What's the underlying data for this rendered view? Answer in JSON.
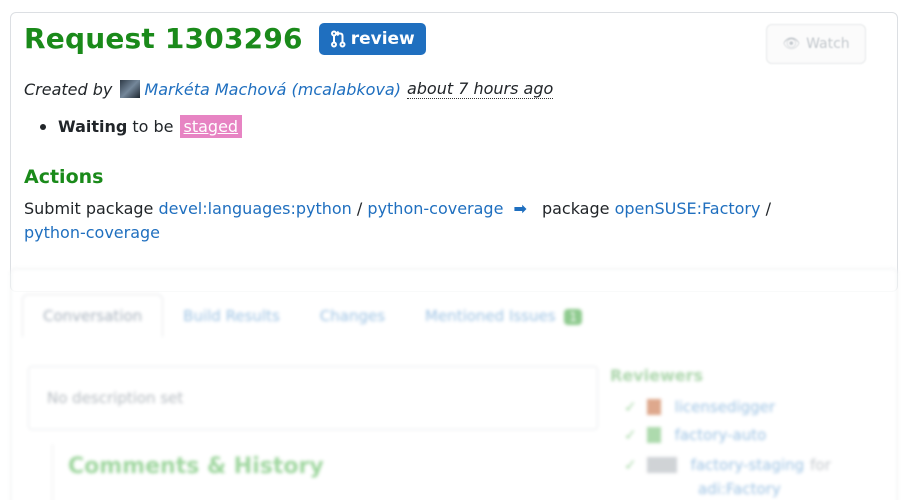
{
  "request": {
    "title": "Request 1303296",
    "badge_label": "review",
    "watch_label": "Watch"
  },
  "created": {
    "prefix": "Created by",
    "user_link": "Markéta Machová (mcalabkova)",
    "time": "about 7 hours ago"
  },
  "status": {
    "state": "Waiting",
    "middle": "to be",
    "target": "staged"
  },
  "actions": {
    "heading": "Actions",
    "prefix": "Submit package",
    "source_project": "devel:languages:python",
    "sep1": "/",
    "source_package": "python-coverage",
    "arrow": "➡",
    "mid": "package",
    "target_project": "openSUSE:Factory",
    "sep2": "/",
    "target_package": "python-coverage"
  },
  "tabs": [
    {
      "label": "Conversation"
    },
    {
      "label": "Build Results"
    },
    {
      "label": "Changes"
    },
    {
      "label": "Mentioned Issues",
      "badge": "1"
    }
  ],
  "description": {
    "text": "No description set"
  },
  "comments": {
    "heading": "Comments & History"
  },
  "reviewers": {
    "heading": "Reviewers",
    "items": [
      {
        "name": "licensedigger"
      },
      {
        "name": "factory-auto"
      },
      {
        "name": "factory-staging",
        "suffix": "for"
      },
      {
        "name": "adi:Factory"
      }
    ]
  },
  "colors": {
    "title_green": "#1a8a1a",
    "link_blue": "#1f6fbf",
    "staged_pink": "#e784c3"
  }
}
